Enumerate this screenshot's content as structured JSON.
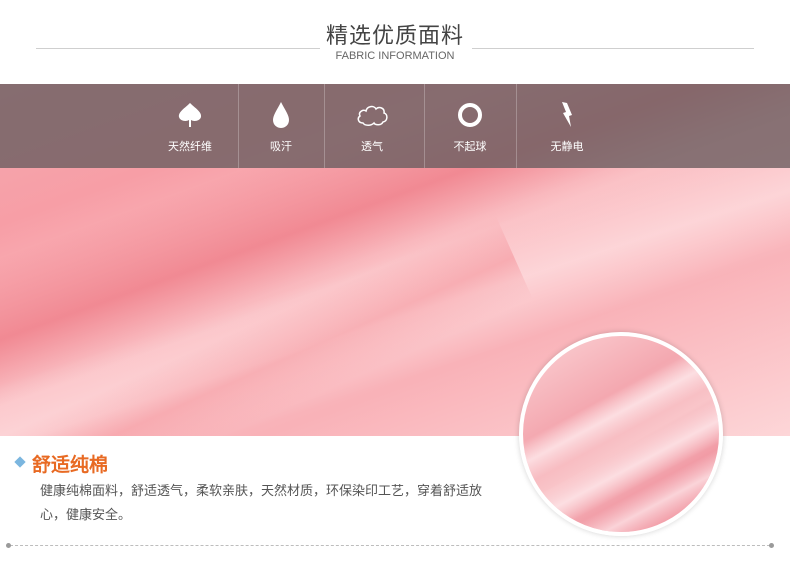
{
  "header": {
    "title": "精选优质面料",
    "subtitle": "FABRIC INFORMATION"
  },
  "features": [
    {
      "label": "天然纤维",
      "icon": "leaf-icon"
    },
    {
      "label": "吸汗",
      "icon": "water-drop-icon"
    },
    {
      "label": "透气",
      "icon": "cloud-icon"
    },
    {
      "label": "不起球",
      "icon": "ring-icon"
    },
    {
      "label": "无静电",
      "icon": "lightning-icon"
    }
  ],
  "section": {
    "title": "舒适纯棉",
    "description": "健康纯棉面料，舒适透气，柔软亲肤，天然材质，环保染印工艺，穿着舒适放心，健康安全。"
  },
  "colors": {
    "accent_title": "#e86a23",
    "diamond": "#7bb6df",
    "feature_bar": "#6e5f62"
  }
}
